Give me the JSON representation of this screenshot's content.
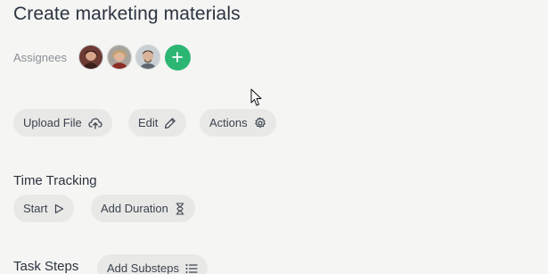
{
  "task": {
    "title": "Create marketing materials"
  },
  "assignees": {
    "label": "Assignees",
    "avatars": [
      "avatar-1",
      "avatar-2",
      "avatar-3"
    ],
    "add_icon": "plus-icon",
    "accent_color": "#2bb673"
  },
  "actions_row": {
    "upload_label": "Upload File",
    "edit_label": "Edit",
    "actions_label": "Actions"
  },
  "time_tracking": {
    "title": "Time Tracking",
    "start_label": "Start",
    "add_duration_label": "Add Duration"
  },
  "task_steps": {
    "title": "Task Steps",
    "add_substeps_label": "Add Substeps"
  }
}
